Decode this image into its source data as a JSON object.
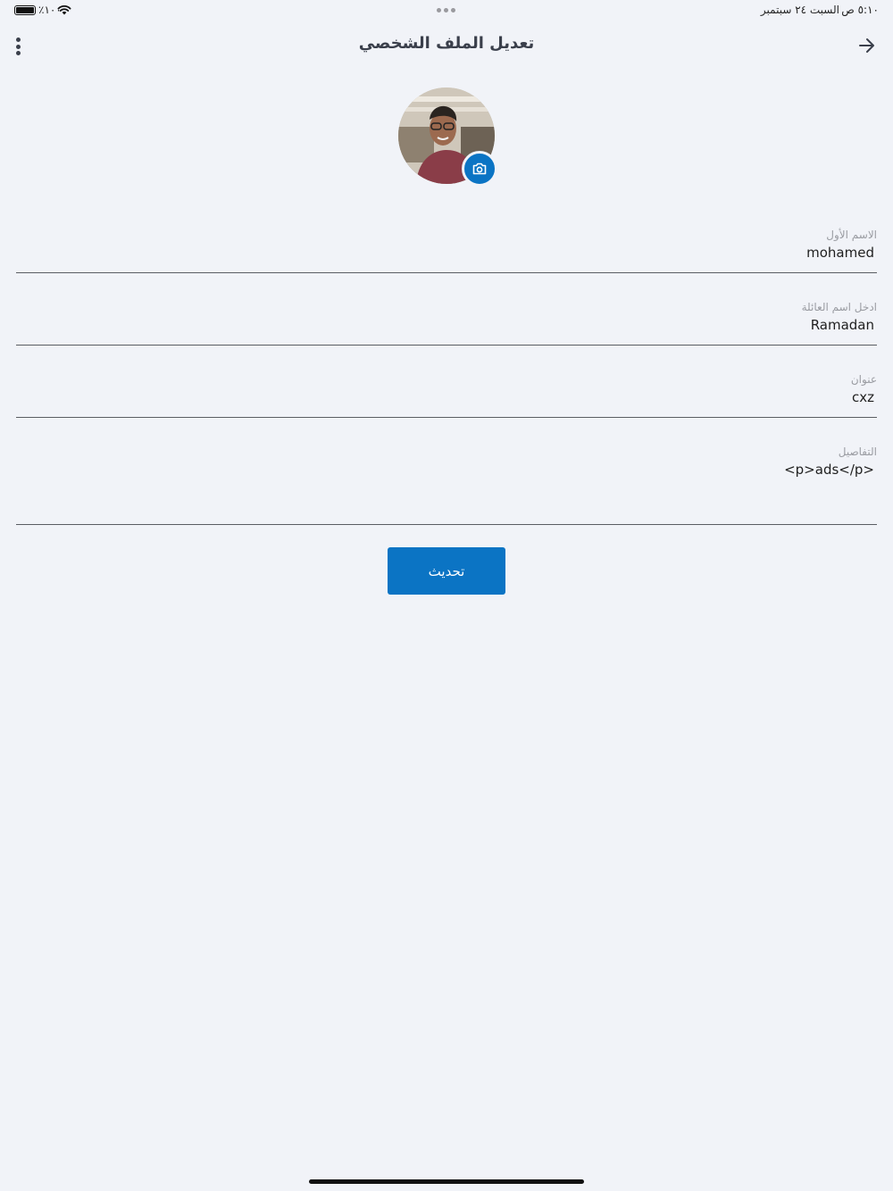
{
  "status_bar": {
    "battery": "٪١٠٠",
    "date": "السبت ٢٤ سبتمبر",
    "time": "٥:١٠ ص"
  },
  "nav": {
    "title": "تعديل الملف الشخصي"
  },
  "form": {
    "first_name": {
      "label": "الاسم الأول",
      "value": "mohamed"
    },
    "last_name": {
      "label": "ادخل اسم العائلة",
      "value": "Ramadan"
    },
    "address": {
      "label": "عنوان",
      "value": "cxz"
    },
    "details": {
      "label": "التفاصيل",
      "value": "<p>ads</p>"
    }
  },
  "update_button": "تحديث",
  "colors": {
    "background": "#f1f3f8",
    "accent": "#0b74c4",
    "title": "#3a3f4b",
    "label": "#9a9ca2"
  },
  "icons": {
    "more": "more-vertical-icon",
    "back": "arrow-right-icon",
    "camera": "camera-icon",
    "wifi": "wifi-icon",
    "battery": "battery-icon"
  }
}
